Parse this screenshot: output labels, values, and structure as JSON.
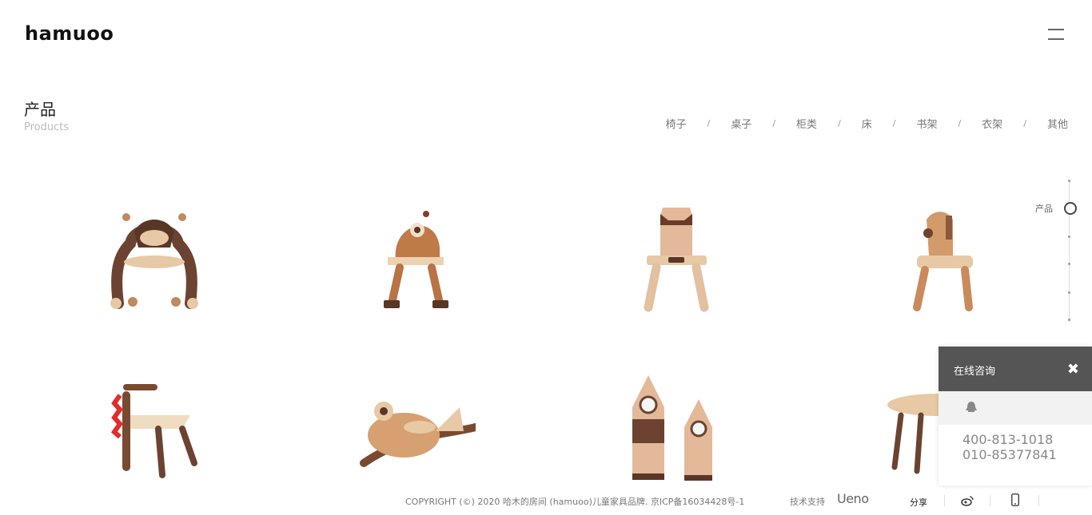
{
  "header": {
    "logo_text": "hamuo",
    "logo_tail": "o",
    "menu_icon": "hamburger-icon"
  },
  "page": {
    "title": "产品",
    "subtitle": "Products"
  },
  "categories": [
    "椅子",
    "桌子",
    "柜类",
    "床",
    "书架",
    "衣架",
    "其他"
  ],
  "category_separator": "/",
  "side_nav": {
    "active_label": "产品"
  },
  "products": [
    {
      "name": "monkey-chair-product"
    },
    {
      "name": "monster-chair-product"
    },
    {
      "name": "bull-chair-product"
    },
    {
      "name": "horse-chair-product"
    },
    {
      "name": "dinosaur-chair-product"
    },
    {
      "name": "fish-rocker-product"
    },
    {
      "name": "rocket-cabinet-product"
    },
    {
      "name": "round-table-product"
    }
  ],
  "footer": {
    "copyright": "COPYRIGHT (©) 2020 哈木的房间 (hamuoo)儿童家具品牌.   京ICP备16034428号-1",
    "tech_label": "技术支持",
    "tech_logo": "Ueno",
    "share_label": "分享",
    "icons": [
      "weibo-icon",
      "phone-icon"
    ]
  },
  "chat": {
    "title": "在线咨询",
    "close_symbol": "✖",
    "phone_1": "400-813-1018",
    "phone_2": "010-85377841"
  },
  "colors": {
    "walnut": "#6b4330",
    "maple": "#e8c9a5",
    "chat_header": "#555555"
  }
}
